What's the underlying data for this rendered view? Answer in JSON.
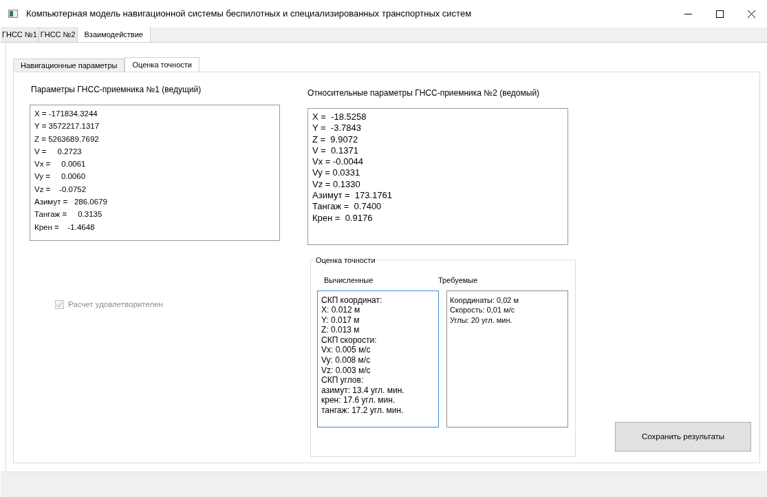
{
  "window": {
    "title": "Компьютерная модель навигационной системы беспилотных и специализированных транспортных систем"
  },
  "main_tabs": [
    {
      "label": "ГНСС №1",
      "selected": false
    },
    {
      "label": "ГНСС №2",
      "selected": false
    },
    {
      "label": "Взаимодействие",
      "selected": true
    }
  ],
  "sub_tabs": [
    {
      "label": "Навигационные параметры",
      "selected": false
    },
    {
      "label": "Оценка точности",
      "selected": true
    }
  ],
  "master": {
    "title": "Параметры ГНСС-приемника №1 (ведущий)",
    "lines": [
      "X = -171834.3244",
      "Y = 3572217.1317",
      "Z = 5263689.7692",
      "V =     0.2723",
      "Vx =     0.0061",
      "Vy =     0.0060",
      "Vz =    -0.0752",
      "Азимут =   286.0679",
      "Тангаж =     0.3135",
      "Крен =    -1.4648"
    ]
  },
  "slave": {
    "title": "Относительные параметры ГНСС-приемника №2 (ведомый)",
    "lines": [
      "X =  -18.5258",
      "Y =  -3.7843",
      "Z =  9.9072",
      "V =  0.1371",
      "Vx = -0.0044",
      "Vy = 0.0331",
      "Vz = 0.1330",
      "Азимут =  173.1761",
      "Тангаж =  0.7400",
      "Крен =  0.9176"
    ]
  },
  "result_checkbox": {
    "label": "Расчет удовлетворителен",
    "checked": true,
    "disabled": true
  },
  "accuracy": {
    "title": "Оценка точности",
    "computed": {
      "label": "Вычисленные",
      "lines": [
        "СКП координат:",
        "X: 0.012 м",
        "Y: 0.017 м",
        "Z: 0.013 м",
        "СКП скорости:",
        "Vx: 0.005 м/с",
        "Vy: 0.008 м/с",
        "Vz: 0.003 м/с",
        "СКП углов:",
        "азимут: 13.4 угл. мин.",
        "крен: 17.6 угл. мин.",
        "тангаж: 17.2 угл. мин."
      ]
    },
    "required": {
      "label": "Требуемые",
      "lines": [
        "Координаты: 0,02 м",
        "Скорость: 0,01 м/с",
        "Углы: 20 угл. мин."
      ]
    }
  },
  "save_button": "Сохранить результаты"
}
